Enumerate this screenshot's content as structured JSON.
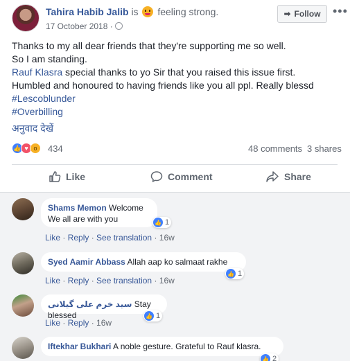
{
  "post": {
    "author": "Tahira Habib Jalib",
    "is_text": "is",
    "feeling": "feeling strong.",
    "date": "17 October 2018 ·",
    "follow_label": "Follow",
    "more_label": "•••",
    "body": {
      "line1": "Thanks to my all dear friends that they're supporting me so well.",
      "line2": "So I am standing.",
      "line3_link": "Rauf Klasra",
      "line3_rest": " special thanks to yo Sir that you raised this issue first.",
      "line4": "Humbled and honoured to having friends like you all ppl. Really blessd",
      "hashtag1": "#Lescoblunder",
      "hashtag2": "#Overbilling"
    },
    "translate": "अनुवाद देखें",
    "reaction_count": "434",
    "comments_count": "48 comments",
    "shares_count": "3 shares"
  },
  "actions": {
    "like": "Like",
    "comment": "Comment",
    "share": "Share"
  },
  "comments": [
    {
      "name": "Shams Memon",
      "text_inline": "Welcome",
      "text_second": "We all are with you",
      "reactions": "1",
      "like": "Like",
      "reply": "Reply",
      "translation": "See translation",
      "time": "16w"
    },
    {
      "name": "Syed Aamir Abbass",
      "text_inline": "Allah aap ko salmaat rakhe",
      "reactions": "1",
      "like": "Like",
      "reply": "Reply",
      "translation": "See translation",
      "time": "16w"
    },
    {
      "name": "سید خرم علی گیلانی",
      "text_inline": "Stay blessed",
      "reactions": "1",
      "like": "Like",
      "reply": "Reply",
      "time": "16w"
    },
    {
      "name": "Iftekhar Bukhari",
      "text_inline": "A noble gesture. Grateful to Rauf klasra.",
      "reactions": "2"
    }
  ],
  "colors": {
    "link": "#365899",
    "like_blue": "#4080ff",
    "love_red": "#f25268",
    "wow_yellow": "#f7b125"
  },
  "icons": [
    "globe-icon",
    "feeling-strong-emoji",
    "follow-icon",
    "more-icon",
    "like-icon",
    "comment-icon",
    "share-icon",
    "like-reaction-icon",
    "love-reaction-icon",
    "wow-reaction-icon"
  ]
}
